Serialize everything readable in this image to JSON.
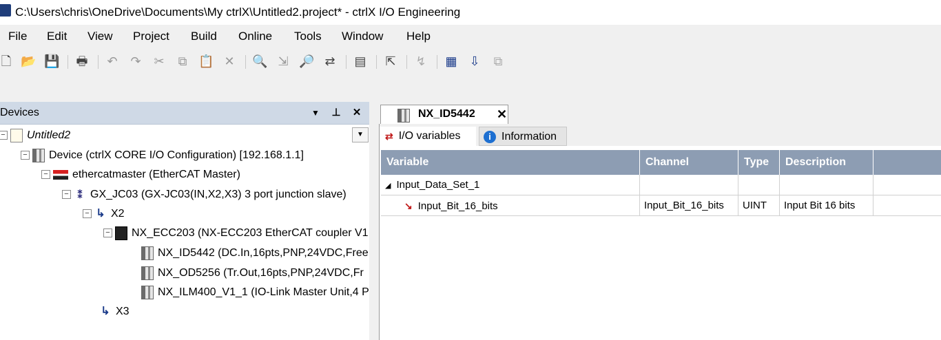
{
  "window": {
    "title": "C:\\Users\\chris\\OneDrive\\Documents\\My ctrlX\\Untitled2.project* - ctrlX I/O Engineering"
  },
  "menu": [
    "File",
    "Edit",
    "View",
    "Project",
    "Build",
    "Online",
    "Tools",
    "Window",
    "Help"
  ],
  "devices_panel": {
    "title": "Devices",
    "tree": [
      {
        "label": "Untitled2",
        "icon": "project-icon"
      },
      {
        "label": "Device (ctrlX CORE I/O Configuration) [192.168.1.1]",
        "icon": "device-icon"
      },
      {
        "label": "ethercatmaster (EtherCAT Master)",
        "icon": "ethercat-master-icon"
      },
      {
        "label": "GX_JC03 (GX-JC03(IN,X2,X3) 3 port junction slave)",
        "icon": "junction-icon"
      },
      {
        "label": "X2",
        "icon": "port-icon"
      },
      {
        "label": "NX_ECC203 (NX-ECC203 EtherCAT coupler V1",
        "icon": "coupler-icon"
      },
      {
        "label": "NX_ID5442 (DC.In,16pts,PNP,24VDC,Free",
        "icon": "io-module-icon"
      },
      {
        "label": "NX_OD5256 (Tr.Out,16pts,PNP,24VDC,Fr",
        "icon": "io-module-icon"
      },
      {
        "label": "NX_ILM400_V1_1 (IO-Link Master Unit,4 P",
        "icon": "io-module-icon"
      },
      {
        "label": "X3",
        "icon": "port-icon"
      }
    ]
  },
  "editor": {
    "document_tab": "NX_ID5442",
    "sub_tabs": [
      "I/O variables",
      "Information"
    ],
    "columns": [
      "Variable",
      "Channel",
      "Type",
      "Description"
    ],
    "rows": [
      {
        "variable": "Input_Data_Set_1",
        "channel": "",
        "type": "",
        "description": ""
      },
      {
        "variable": "Input_Bit_16_bits",
        "channel": "Input_Bit_16_bits",
        "type": "UINT",
        "description": "Input Bit 16 bits"
      }
    ]
  }
}
